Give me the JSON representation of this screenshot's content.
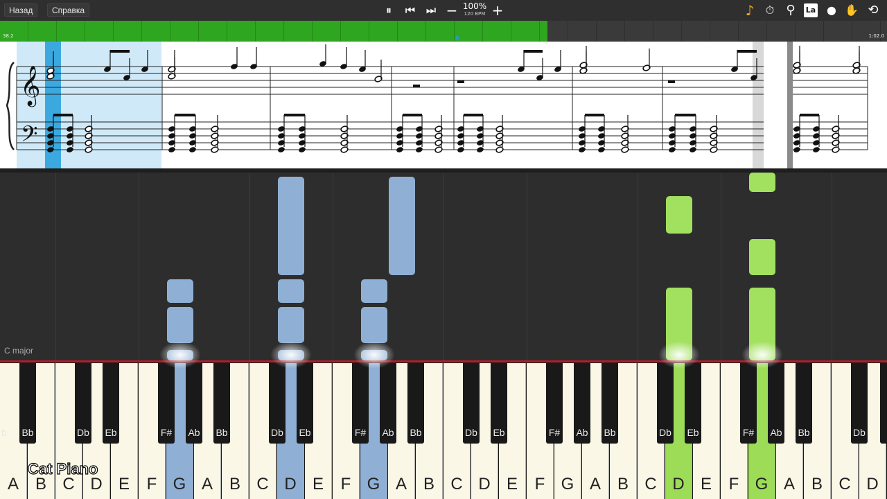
{
  "toolbar": {
    "back_label": "Назад",
    "help_label": "Справка",
    "speed_percent": "100%",
    "tempo": "120 BPM",
    "pause_icon": "⏸",
    "prev_icon": "⏮",
    "next_icon": "⏭",
    "minus_icon": "−",
    "plus_icon": "+",
    "note_icon": "♪",
    "metronome_icon": "⏱",
    "search_icon": "⚲",
    "labels_toggle_text": "La",
    "location_icon": "⬤",
    "hand_icon": "✋",
    "loop_icon": "⟲"
  },
  "timeline": {
    "start_time": "38.2",
    "end_time": "1:02.0",
    "progress_fraction": 0.617,
    "marker_fraction": 0.516
  },
  "piano_roll": {
    "key_signature": "C major"
  },
  "keyboard": {
    "white_labels": [
      "A",
      "B",
      "C",
      "D",
      "E",
      "F",
      "G",
      "A",
      "B",
      "C",
      "D",
      "E",
      "F",
      "G",
      "A",
      "B",
      "C",
      "D",
      "E",
      "F",
      "G",
      "A",
      "B",
      "C",
      "D",
      "E",
      "F",
      "G",
      "A",
      "B",
      "C",
      "D"
    ],
    "black_labels": [
      "Bb",
      "Db",
      "Eb",
      "F#",
      "Ab",
      "Bb",
      "Db",
      "Eb",
      "F#",
      "Ab",
      "Bb",
      "Db",
      "Eb",
      "F#",
      "Ab",
      "Bb",
      "Db",
      "Eb",
      "F#",
      "Ab",
      "Bb",
      "Db"
    ],
    "edge_label": "b",
    "highlighted": [
      {
        "note": "G",
        "hand": "left"
      },
      {
        "note": "D",
        "hand": "left"
      },
      {
        "note": "G",
        "hand": "left"
      },
      {
        "note": "D",
        "hand": "right"
      },
      {
        "note": "G",
        "hand": "right"
      }
    ]
  },
  "colors": {
    "left_hand": "#8fb0d4",
    "right_hand": "#9cdc57",
    "timeline_progress": "#2ea61f",
    "selection": "#cfe9f8",
    "cursor": "#3ba9e0"
  },
  "watermark": "Cat Piano"
}
